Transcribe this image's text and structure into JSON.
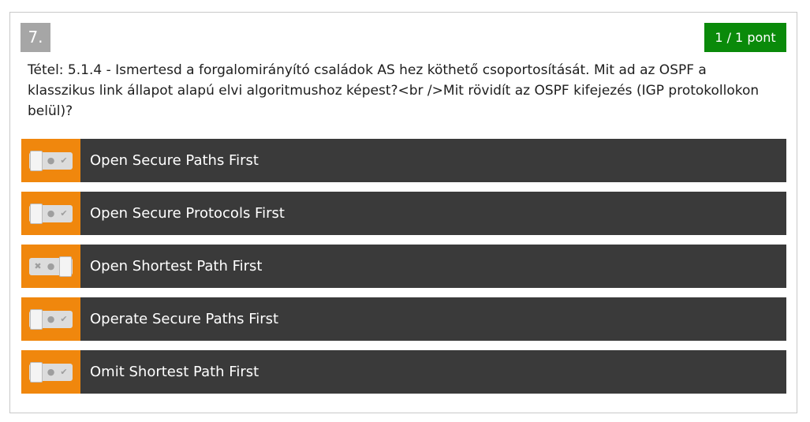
{
  "question": {
    "number": "7.",
    "score": "1 / 1 pont",
    "text": "Tétel: 5.1.4 - Ismertesd a forgalomirányító családok AS hez köthető csoportosítását. Mit ad az OSPF a klasszikus link állapot alapú elvi algoritmushoz képest?<br />Mit rövidít az OSPF kifejezés (IGP protokollokon belül)?"
  },
  "colors": {
    "accent_orange": "#f0870d",
    "score_green": "#0a8a0a",
    "option_bg": "#3a3a3a",
    "number_bg": "#a6a6a6"
  },
  "options": [
    {
      "label": "Open Secure Paths First",
      "toggle_state": "no"
    },
    {
      "label": "Open Secure Protocols First",
      "toggle_state": "no"
    },
    {
      "label": "Open Shortest Path First",
      "toggle_state": "yes"
    },
    {
      "label": "Operate Secure Paths First",
      "toggle_state": "no"
    },
    {
      "label": "Omit Shortest Path First",
      "toggle_state": "no"
    }
  ],
  "icons": {
    "no": "✖",
    "neutral": "●",
    "yes": "✔"
  }
}
